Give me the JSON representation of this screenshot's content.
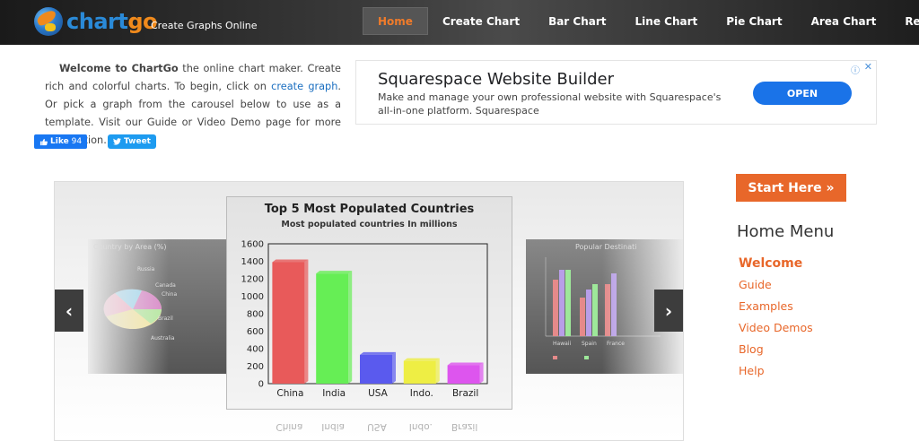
{
  "header": {
    "logo_prefix": "chart",
    "logo_suffix": "go",
    "tagline": "Create Graphs Online",
    "nav": [
      {
        "label": "Home",
        "active": true
      },
      {
        "label": "Create Chart",
        "active": false
      },
      {
        "label": "Bar Chart",
        "active": false
      },
      {
        "label": "Line Chart",
        "active": false
      },
      {
        "label": "Pie Chart",
        "active": false
      },
      {
        "label": "Area Chart",
        "active": false
      },
      {
        "label": "Result",
        "active": false
      }
    ]
  },
  "welcome": {
    "bold": "Welcome to ChartGo",
    "text1": " the online chart maker. Create rich and colorful charts. To begin, click on ",
    "link": "create graph",
    "text2": ". Or pick a graph from the carousel below to use as a template. Visit our Guide or Video Demo page for more information."
  },
  "social": {
    "like_label": "Like",
    "like_count": "94",
    "tweet_label": "Tweet"
  },
  "ad": {
    "title": "Squarespace Website Builder",
    "description": "Make and manage your own professional website with Squarespace's all-in-one platform. Squarespace",
    "button": "OPEN"
  },
  "carousel": {
    "left_card_title": "Country by Area (%)",
    "right_card_title": "Popular Destinati",
    "prev_icon": "chevron-left-icon",
    "next_icon": "chevron-right-icon"
  },
  "chart_data": {
    "type": "bar",
    "title": "Top 5 Most Populated Countries",
    "subtitle": "Most populated countries In millions",
    "categories": [
      "China",
      "India",
      "USA",
      "Indo.",
      "Brazil"
    ],
    "values": [
      1390,
      1260,
      330,
      260,
      210
    ],
    "colors": [
      "#e85a5a",
      "#66ee55",
      "#5a5aee",
      "#eeee44",
      "#dd55ee"
    ],
    "ylim": [
      0,
      1600
    ],
    "yticks": [
      "1600",
      "1400",
      "1200",
      "1000",
      "800",
      "600",
      "400",
      "200",
      "0"
    ],
    "xlabel": "",
    "ylabel": ""
  },
  "sidebar": {
    "start_button": "Start Here »",
    "menu_title": "Home Menu",
    "menu_items": [
      "Welcome",
      "Guide",
      "Examples",
      "Video Demos",
      "Blog",
      "Help"
    ]
  },
  "colors": {
    "accent": "#e8672a",
    "link": "#1a6ec0",
    "header_bg": "#2b2b2b"
  }
}
